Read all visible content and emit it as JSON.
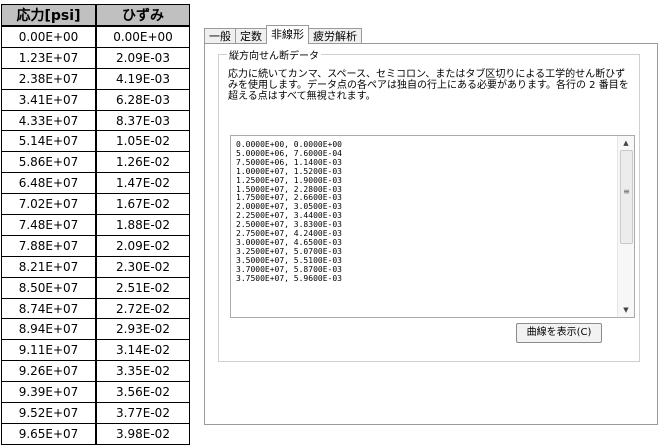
{
  "table": {
    "headers": [
      "応力[psi]",
      "ひずみ"
    ],
    "rows": [
      [
        "0.00E+00",
        "0.00E+00"
      ],
      [
        "1.23E+07",
        "2.09E-03"
      ],
      [
        "2.38E+07",
        "4.19E-03"
      ],
      [
        "3.41E+07",
        "6.28E-03"
      ],
      [
        "4.33E+07",
        "8.37E-03"
      ],
      [
        "5.14E+07",
        "1.05E-02"
      ],
      [
        "5.86E+07",
        "1.26E-02"
      ],
      [
        "6.48E+07",
        "1.47E-02"
      ],
      [
        "7.02E+07",
        "1.67E-02"
      ],
      [
        "7.48E+07",
        "1.88E-02"
      ],
      [
        "7.88E+07",
        "2.09E-02"
      ],
      [
        "8.21E+07",
        "2.30E-02"
      ],
      [
        "8.50E+07",
        "2.51E-02"
      ],
      [
        "8.74E+07",
        "2.72E-02"
      ],
      [
        "8.94E+07",
        "2.93E-02"
      ],
      [
        "9.11E+07",
        "3.14E-02"
      ],
      [
        "9.26E+07",
        "3.35E-02"
      ],
      [
        "9.39E+07",
        "3.56E-02"
      ],
      [
        "9.52E+07",
        "3.77E-02"
      ],
      [
        "9.65E+07",
        "3.98E-02"
      ]
    ]
  },
  "dialog": {
    "tabs": [
      "一般",
      "定数",
      "非線形",
      "疲労解析"
    ],
    "active_tab": "非線形",
    "group_title": "縦方向せん断データ",
    "description": "応力に続いてカンマ、スペース、セミコロン、またはタブ区切りによる工学的せん断ひずみを使用します。データ点の各ペアは独自の行上にある必要があります。各行の 2 番目を超える点はすべて無視されます。",
    "data_lines": [
      "0.0000E+00, 0.0000E+00",
      "5.0000E+06, 7.6000E-04",
      "7.5000E+06, 1.1400E-03",
      "1.0000E+07, 1.5200E-03",
      "1.2500E+07, 1.9000E-03",
      "1.5000E+07, 2.2800E-03",
      "1.7500E+07, 2.6600E-03",
      "2.0000E+07, 3.0500E-03",
      "2.2500E+07, 3.4400E-03",
      "2.5000E+07, 3.8300E-03",
      "2.7500E+07, 4.2400E-03",
      "3.0000E+07, 4.6500E-03",
      "3.2500E+07, 5.0700E-03",
      "3.5000E+07, 5.5100E-03",
      "3.7000E+07, 5.8700E-03",
      "3.7500E+07, 5.9600E-03"
    ],
    "show_curve_button": "曲線を表示(C)"
  }
}
